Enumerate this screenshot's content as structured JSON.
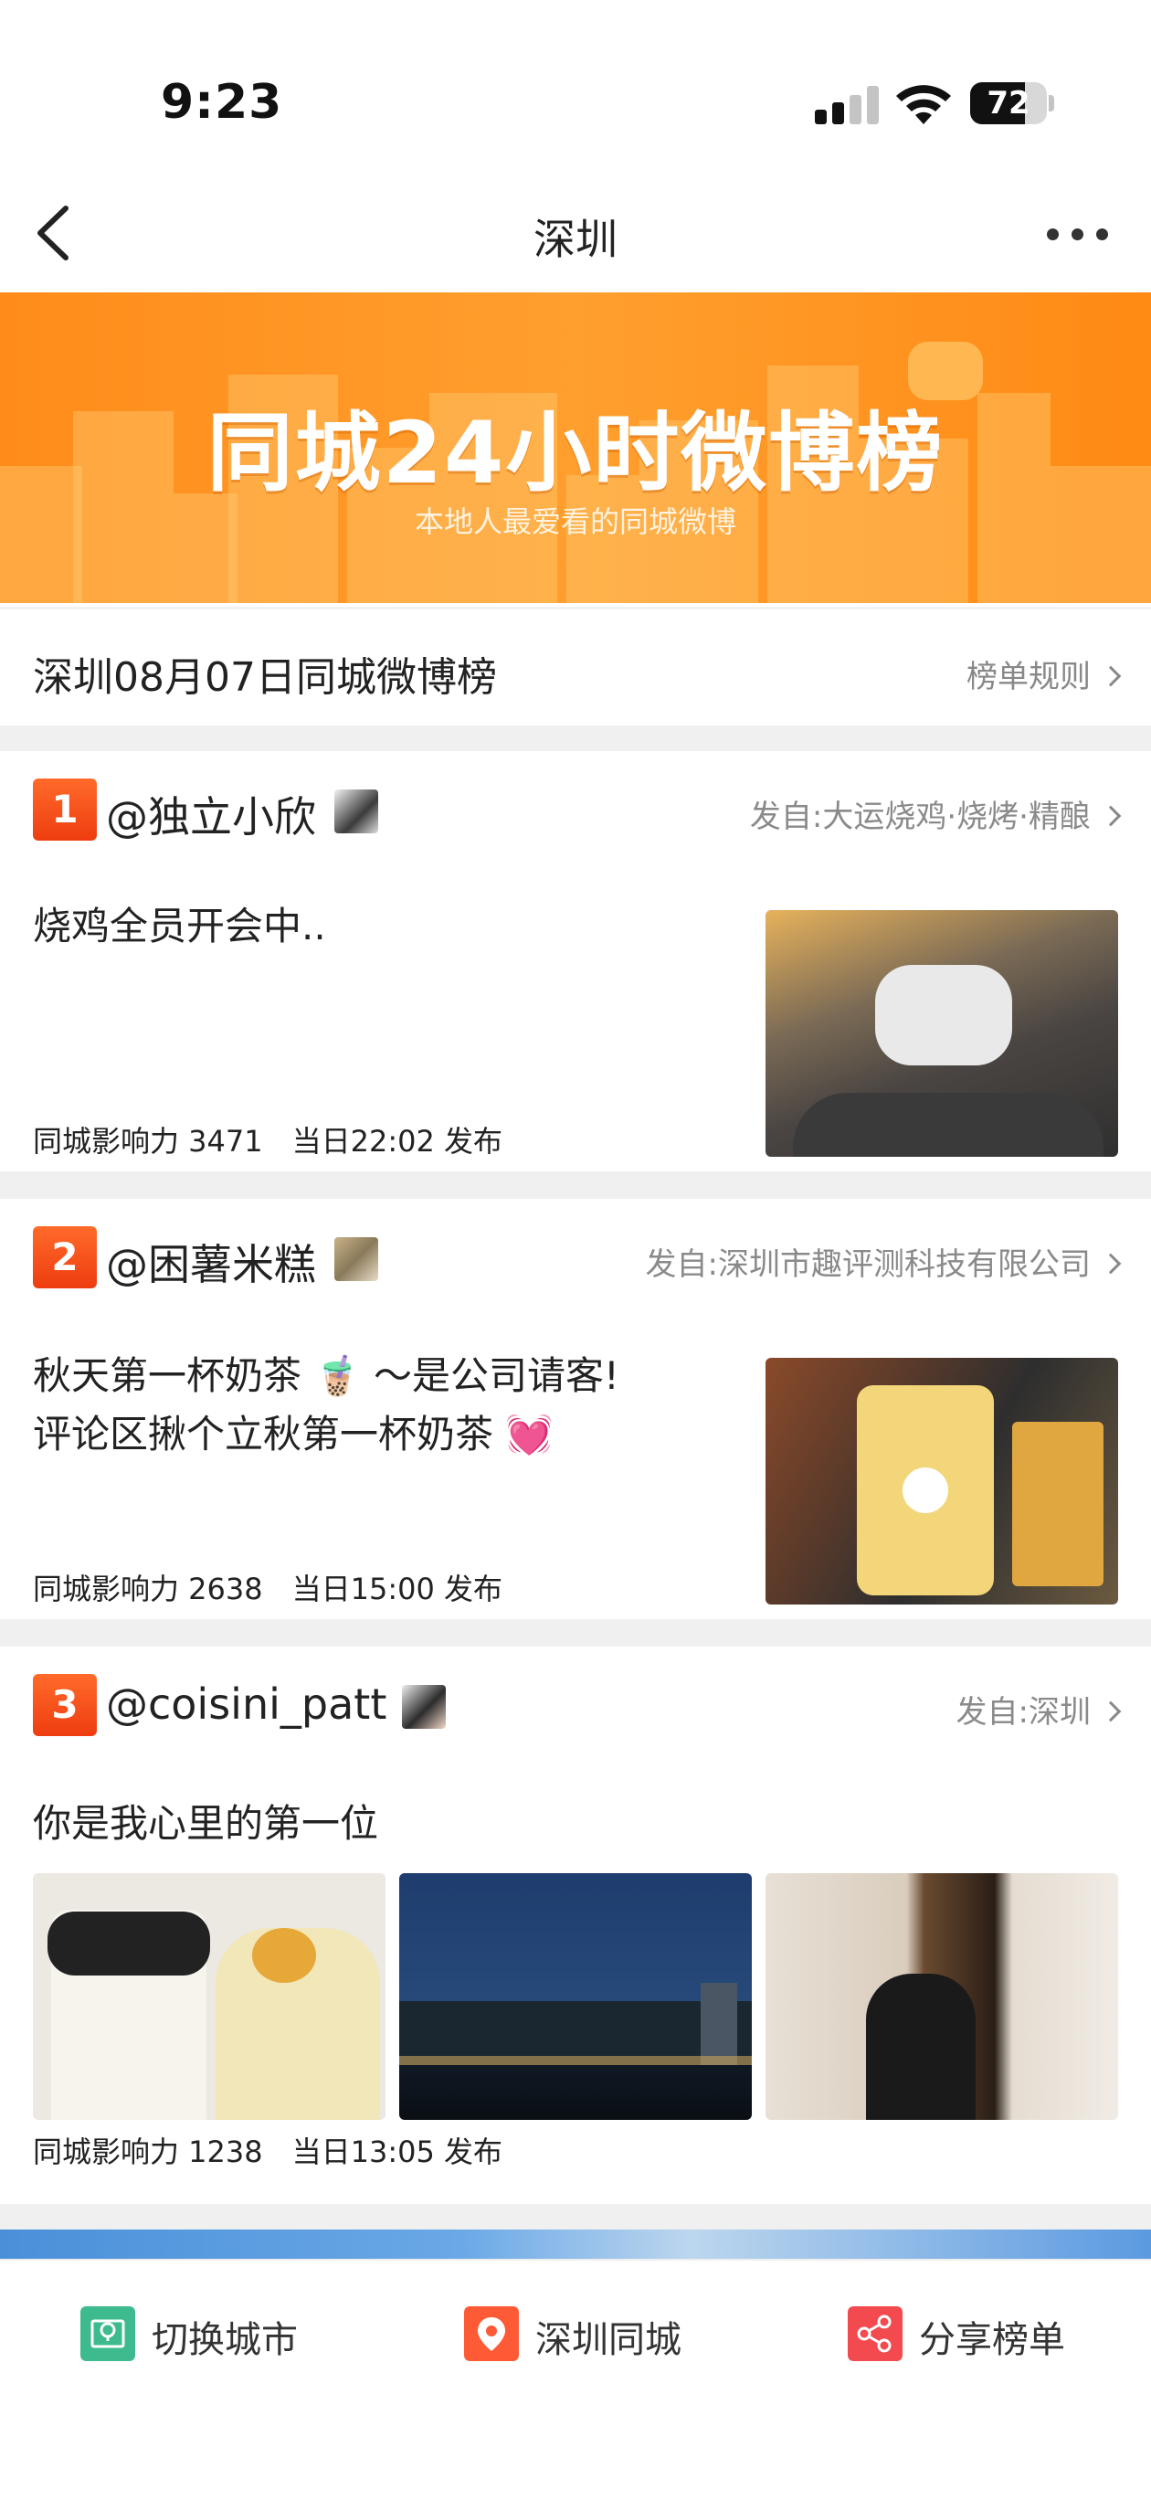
{
  "status_bar": {
    "time": "9:23",
    "battery": "72",
    "battery_level": 0.72
  },
  "nav": {
    "title": "深圳"
  },
  "banner": {
    "title": "同城24小时微博榜",
    "subtitle": "本地人最爱看的同城微博"
  },
  "section": {
    "title": "深圳08月07日同城微博榜",
    "rules_label": "榜单规则"
  },
  "entries": [
    {
      "rank": "1",
      "author": "@独立小欣",
      "source": "发自:大运烧鸡·烧烤·精酿",
      "content": "烧鸡全员开会中..",
      "influence": "同城影响力 3471",
      "time": "当日22:02 发布"
    },
    {
      "rank": "2",
      "author": "@困薯米糕",
      "source": "发自:深圳市趣评测科技有限公司",
      "content_line1": "秋天第一杯奶茶 🧋 ～是公司请客!",
      "content_line2": "评论区揪个立秋第一杯奶茶 💓",
      "influence": "同城影响力 2638",
      "time": "当日15:00 发布"
    },
    {
      "rank": "3",
      "author": "@coisini_patt",
      "source": "发自:深圳",
      "content": "你是我心里的第一位",
      "influence": "同城影响力 1238",
      "time": "当日13:05 发布"
    }
  ],
  "bottom_bar": {
    "switch_city": "切换城市",
    "local_city": "深圳同城",
    "share_list": "分享榜单"
  },
  "colors": {
    "banner_orange": "#ff8c1a",
    "rank_red": "#ee3d10",
    "switch_icon": "#3dbb8e",
    "location_icon": "#ff5a36",
    "share_icon": "#f24a4f"
  }
}
